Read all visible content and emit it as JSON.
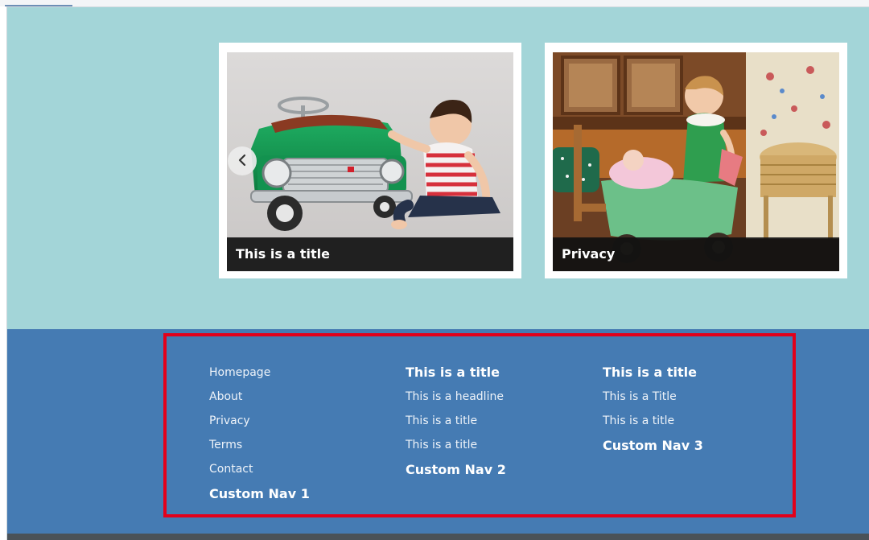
{
  "colors": {
    "hero_bg": "#a3d5d8",
    "footer_bg": "#457bb3",
    "highlight_border": "#e3001b",
    "caption_bg": "#111111"
  },
  "carousel": {
    "prev_icon": "chevron-left-icon",
    "slides": [
      {
        "caption": "This is a title"
      },
      {
        "caption": "Privacy"
      }
    ]
  },
  "footer": {
    "col1": {
      "links": [
        "Homepage",
        "About",
        "Privacy",
        "Terms",
        "Contact"
      ],
      "custom_nav": "Custom Nav 1"
    },
    "col2": {
      "heading": "This is a title",
      "links": [
        "This is a headline",
        "This is a title",
        "This is a title"
      ],
      "custom_nav": "Custom Nav 2"
    },
    "col3": {
      "heading": "This is a title",
      "links": [
        "This is a Title",
        "This is a title"
      ],
      "custom_nav": "Custom Nav 3"
    }
  }
}
